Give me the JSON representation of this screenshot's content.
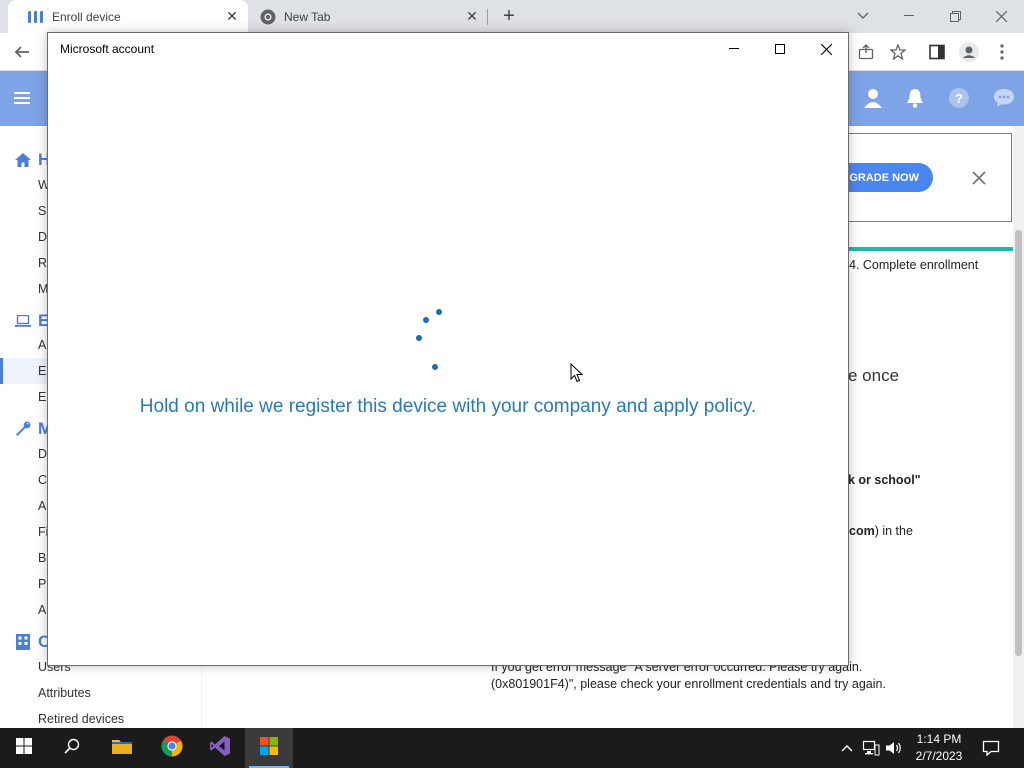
{
  "browser": {
    "tabs": [
      {
        "title": "Enroll device",
        "icon": "app-icon",
        "active": true
      },
      {
        "title": "New Tab",
        "icon": "chrome-icon",
        "active": false
      }
    ],
    "new_tab": "+"
  },
  "nav": {
    "sections": [
      {
        "label": "H",
        "icon": "home-icon"
      },
      {
        "label": "E",
        "icon": "laptop-icon"
      },
      {
        "label": "M",
        "icon": "wrench-icon"
      },
      {
        "label": "C",
        "icon": "building-icon"
      }
    ],
    "items": [
      "W",
      "Se",
      "D",
      "R",
      "M",
      "A",
      "E",
      "E",
      "D",
      "C",
      "A",
      "Fi",
      "B",
      "P",
      "A",
      "Users",
      "Attributes",
      "Retired devices"
    ]
  },
  "content": {
    "upgrade_label": "UPGRADE NOW",
    "step4": "4. Complete enrollment",
    "frag_once": "e once",
    "frag_school": "k or school\"",
    "frag_com_bold": "com",
    "frag_com_rest": ") in the",
    "error_line1": "If you get error message \"A server error occurred. Please try again.",
    "error_line2": "(0x801901F4)\", please check your enrollment credentials and try again."
  },
  "dialog": {
    "title": "Microsoft account",
    "message": "Hold on while we register this device with your company and apply policy."
  },
  "taskbar": {
    "time": "1:14 PM",
    "date": "2/7/2023"
  },
  "colors": {
    "header_blue": "#7ea3e6",
    "accent_blue": "#4a7fd6",
    "dialog_text": "#2a7ab8",
    "progress_teal": "#21b8a8"
  }
}
